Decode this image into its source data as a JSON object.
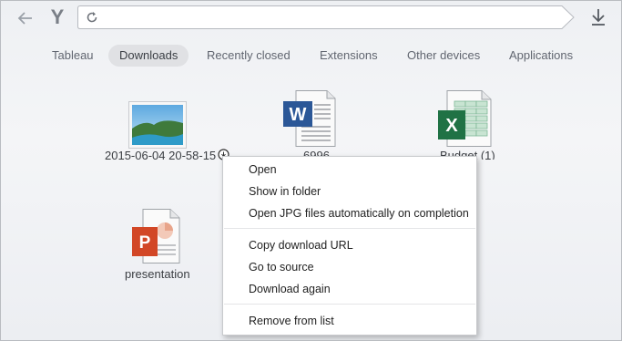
{
  "toolbar": {
    "back_icon": "back-arrow-icon",
    "logo_letter": "Y",
    "address_value": "",
    "reload_icon": "reload-icon",
    "download_icon": "download-arrow-icon"
  },
  "tabs": [
    {
      "label": "Tableau",
      "active": false
    },
    {
      "label": "Downloads",
      "active": true
    },
    {
      "label": "Recently closed",
      "active": false
    },
    {
      "label": "Extensions",
      "active": false
    },
    {
      "label": "Other devices",
      "active": false
    },
    {
      "label": "Applications",
      "active": false
    }
  ],
  "files": [
    {
      "name": "2015-06-04 20-58-15",
      "type": "image",
      "in_progress": true
    },
    {
      "name": "6996",
      "type": "word"
    },
    {
      "name": "Budget (1)",
      "type": "excel"
    },
    {
      "name": "presentation",
      "type": "powerpoint"
    }
  ],
  "context_menu": {
    "items": [
      {
        "label": "Open"
      },
      {
        "label": "Show in folder"
      },
      {
        "label": "Open JPG files automatically on completion"
      },
      {
        "label": "Copy download URL"
      },
      {
        "label": "Go to source"
      },
      {
        "label": "Download again"
      },
      {
        "label": "Remove from list"
      }
    ]
  },
  "colors": {
    "word_blue": "#2b5797",
    "excel_green": "#207245",
    "powerpoint_red": "#d24726"
  }
}
